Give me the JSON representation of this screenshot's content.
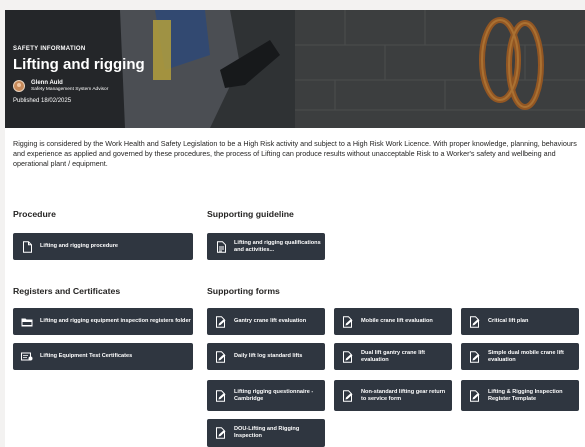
{
  "hero": {
    "tag": "SAFETY INFORMATION",
    "title": "Lifting and rigging",
    "author_name": "Glenn Auld",
    "author_role": "Safety Management System Advisor",
    "published": "Published 18/02/2025"
  },
  "intro": "Rigging is considered by the Work Health and Safety Legislation to be a High Risk activity and subject to a High Risk Work Licence. With proper knowledge, planning, behaviours and experience as applied and governed by these procedures, the process of Lifting can produce results without unacceptable Risk to a Worker's safety and wellbeing and operational plant / equipment.",
  "sections": {
    "procedure": "Procedure",
    "supporting_guideline": "Supporting guideline",
    "registers": "Registers and Certificates",
    "supporting_forms": "Supporting forms"
  },
  "procedure_tiles": [
    {
      "label": "Lifting and rigging procedure",
      "icon": "document-icon"
    }
  ],
  "guideline_tiles": [
    {
      "label": "Lifting and rigging qualifications and activities...",
      "icon": "guideline-icon"
    }
  ],
  "register_tiles": [
    {
      "label": "Lifting and rigging equipment inspection registers folder",
      "icon": "folder-icon"
    },
    {
      "label": "Lifting Equipment Test Certificates",
      "icon": "certificate-icon"
    }
  ],
  "form_tiles": [
    {
      "label": "Gantry crane lift evaluation",
      "icon": "form-icon"
    },
    {
      "label": "Mobile crane lift evaluation",
      "icon": "form-icon"
    },
    {
      "label": "Critical lift plan",
      "icon": "form-icon"
    },
    {
      "label": "Daily lift log standard lifts",
      "icon": "form-icon"
    },
    {
      "label": "Dual lift gantry crane lift evaluation",
      "icon": "form-icon"
    },
    {
      "label": "Simple dual mobile crane lift evaluation",
      "icon": "form-icon"
    },
    {
      "label": "Lifting rigging questionnaire - Cambridge",
      "icon": "form-icon"
    },
    {
      "label": "Non-standard lifting gear return to service form",
      "icon": "form-icon"
    },
    {
      "label": "Lifting & Rigging Inspection Register Template",
      "icon": "form-icon"
    },
    {
      "label": "DOU-Lifting and Rigging Inspection",
      "icon": "form-icon"
    }
  ]
}
